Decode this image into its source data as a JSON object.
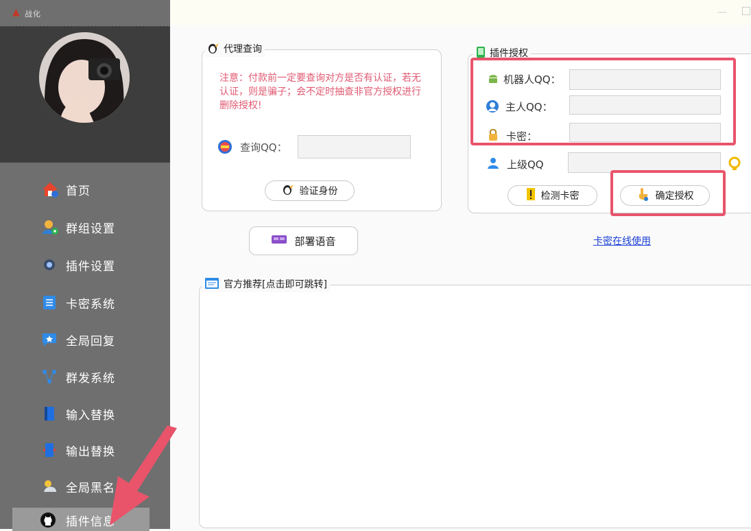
{
  "app": {
    "title_text": "战化"
  },
  "colors": {
    "sidebar_bg": "#6f6f6f",
    "accent_red": "#e9546b",
    "link_blue": "#1a3fd6"
  },
  "sidebar": {
    "items": [
      {
        "label": "首页",
        "icon": "home-icon"
      },
      {
        "label": "群组设置",
        "icon": "group-icon"
      },
      {
        "label": "插件设置",
        "icon": "settings-icon"
      },
      {
        "label": "卡密系统",
        "icon": "card-icon"
      },
      {
        "label": "全局回复",
        "icon": "reply-icon"
      },
      {
        "label": "群发系统",
        "icon": "broadcast-icon"
      },
      {
        "label": "输入替换",
        "icon": "input-replace-icon"
      },
      {
        "label": "输出替换",
        "icon": "output-replace-icon"
      },
      {
        "label": "全局黑名",
        "icon": "blacklist-icon"
      },
      {
        "label": "插件信息",
        "icon": "github-icon",
        "active": true
      }
    ]
  },
  "proxy_query": {
    "title": "代理查询",
    "warning": "注意：付款前一定要查询对方是否有认证，若无认证，则是骗子；会不定时抽查非官方授权进行删除授权!",
    "query_label": "查询QQ：",
    "query_value": "",
    "verify_button": "验证身份"
  },
  "deploy_button": "部署语音",
  "plugin_auth": {
    "title": "插件授权",
    "robot_label": "机器人QQ：",
    "robot_value": "",
    "owner_label": "主人QQ：",
    "owner_value": "",
    "card_label": "卡密：",
    "card_value": "",
    "parent_label": "上级QQ",
    "parent_value": "",
    "check_button": "检测卡密",
    "confirm_button": "确定授权"
  },
  "online_link": "卡密在线使用",
  "recommend": {
    "title": "官方推荐[点击即可跳转]"
  }
}
